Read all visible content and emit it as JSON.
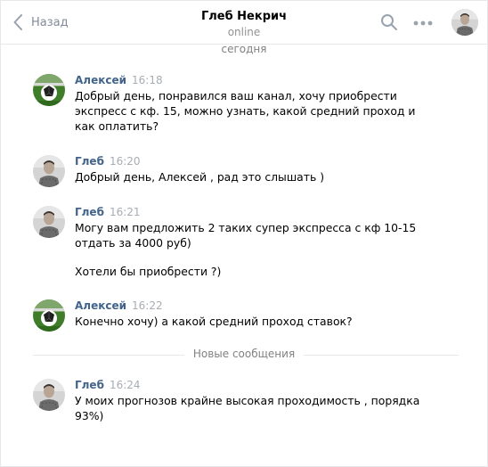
{
  "header": {
    "back_label": "Назад",
    "title": "Глеб Некрич",
    "status": "online"
  },
  "day_label": "сегодня",
  "new_messages_label": "Новые сообщения",
  "messages": [
    {
      "author": "Алексей",
      "time": "16:18",
      "avatar": "football-avatar",
      "texts": [
        "Добрый день, понравился ваш канал, хочу приобрести экспресс с кф. 15, можно узнать, какой средний проход и как оплатить?"
      ]
    },
    {
      "author": "Глеб",
      "time": "16:20",
      "avatar": "person-avatar",
      "texts": [
        "Добрый день, Алексей , рад это слышать )"
      ]
    },
    {
      "author": "Глеб",
      "time": "16:21",
      "avatar": "person-avatar",
      "texts": [
        "Могу вам предложить 2 таких супер экспресса с кф 10-15 отдать за 4000 руб)",
        "Хотели бы приобрести ?)"
      ]
    },
    {
      "author": "Алексей",
      "time": "16:22",
      "avatar": "football-avatar",
      "texts": [
        "Конечно хочу) а какой средний проход ставок?"
      ]
    },
    {
      "author": "Глеб",
      "time": "16:24",
      "avatar": "person-avatar",
      "texts": [
        "У моих прогнозов крайне высокая проходимость , порядка 93%)"
      ]
    }
  ],
  "colors": {
    "author": "#42648b",
    "muted": "#828a99",
    "border": "#e7e8ec"
  }
}
